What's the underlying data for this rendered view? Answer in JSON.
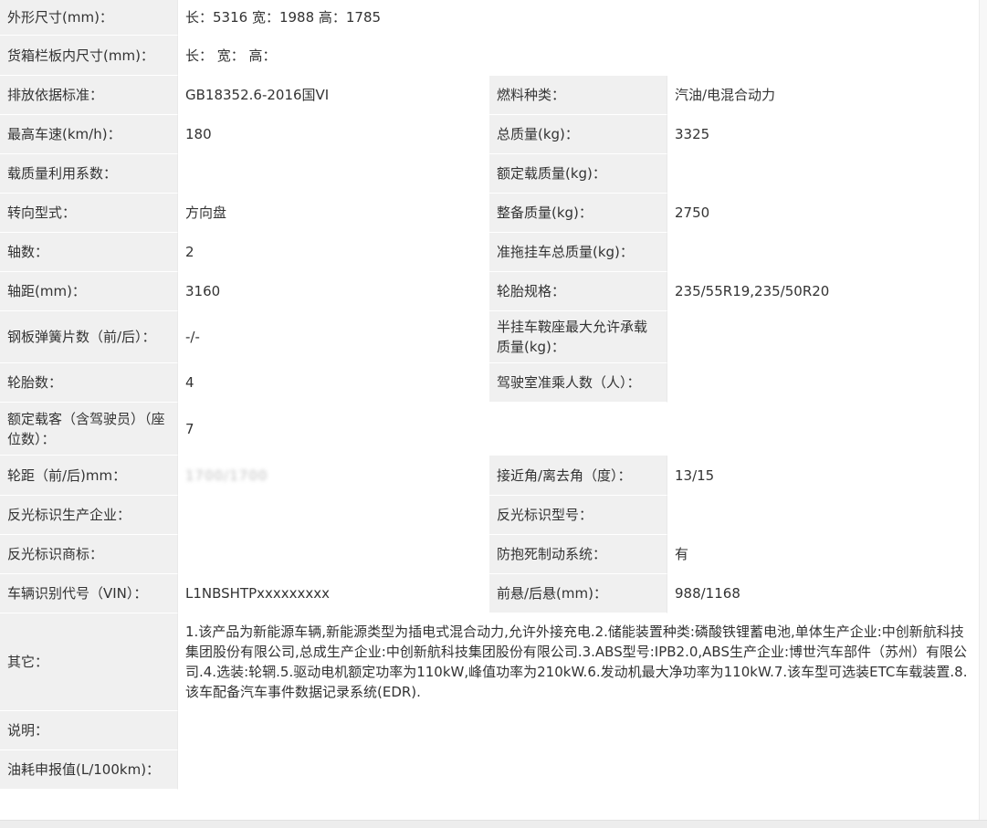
{
  "rows": [
    {
      "label": "外形尺寸(mm)：",
      "value": "长：5316 宽：1988 高：1785"
    },
    {
      "label": "货箱栏板内尺寸(mm)：",
      "value": "长： 宽： 高："
    },
    {
      "label": "排放依据标准：",
      "value": "GB18352.6-2016国VI",
      "label2": "燃料种类：",
      "value2": "汽油/电混合动力"
    },
    {
      "label": "最高车速(km/h)：",
      "value": "180",
      "label2": "总质量(kg)：",
      "value2": "3325"
    },
    {
      "label": "载质量利用系数：",
      "value": "",
      "label2": "额定载质量(kg)：",
      "value2": ""
    },
    {
      "label": "转向型式：",
      "value": "方向盘",
      "label2": "整备质量(kg)：",
      "value2": "2750"
    },
    {
      "label": "轴数：",
      "value": "2",
      "label2": "准拖挂车总质量(kg)：",
      "value2": ""
    },
    {
      "label": "轴距(mm)：",
      "value": "3160",
      "label2": "轮胎规格：",
      "value2": "235/55R19,235/50R20"
    },
    {
      "label": "钢板弹簧片数（前/后）：",
      "value": "-/-",
      "label2": "半挂车鞍座最大允许承载质量(kg)：",
      "value2": ""
    },
    {
      "label": "轮胎数：",
      "value": "4",
      "label2": "驾驶室准乘人数（人）：",
      "value2": ""
    },
    {
      "label": "额定载客（含驾驶员）（座位数）：",
      "value": "7"
    },
    {
      "label": "轮距（前/后)mm：",
      "value": "1700/1700",
      "label2": "接近角/离去角（度）：",
      "value2": "13/15"
    },
    {
      "label": "反光标识生产企业：",
      "value": "",
      "label2": "反光标识型号：",
      "value2": ""
    },
    {
      "label": "反光标识商标：",
      "value": "",
      "label2": "防抱死制动系统：",
      "value2": "有"
    },
    {
      "label": "车辆识别代号（VIN）：",
      "value": "L1NBSHTPxxxxxxxxx",
      "label2": "前悬/后悬(mm)：",
      "value2": "988/1168"
    },
    {
      "label": "其它：",
      "value": "1.该产品为新能源车辆,新能源类型为插电式混合动力,允许外接充电.2.储能装置种类:磷酸铁锂蓄电池,单体生产企业:中创新航科技集团股份有限公司,总成生产企业:中创新航科技集团股份有限公司.3.ABS型号:IPB2.0,ABS生产企业:博世汽车部件（苏州）有限公司.4.选装:轮辋.5.驱动电机额定功率为110kW,峰值功率为210kW.6.发动机最大净功率为110kW.7.该车型可选装ETC车载装置.8.该车配备汽车事件数据记录系统(EDR)."
    },
    {
      "label": "说明：",
      "value": ""
    },
    {
      "label": "油耗申报值(L/100km)：",
      "value": ""
    }
  ]
}
